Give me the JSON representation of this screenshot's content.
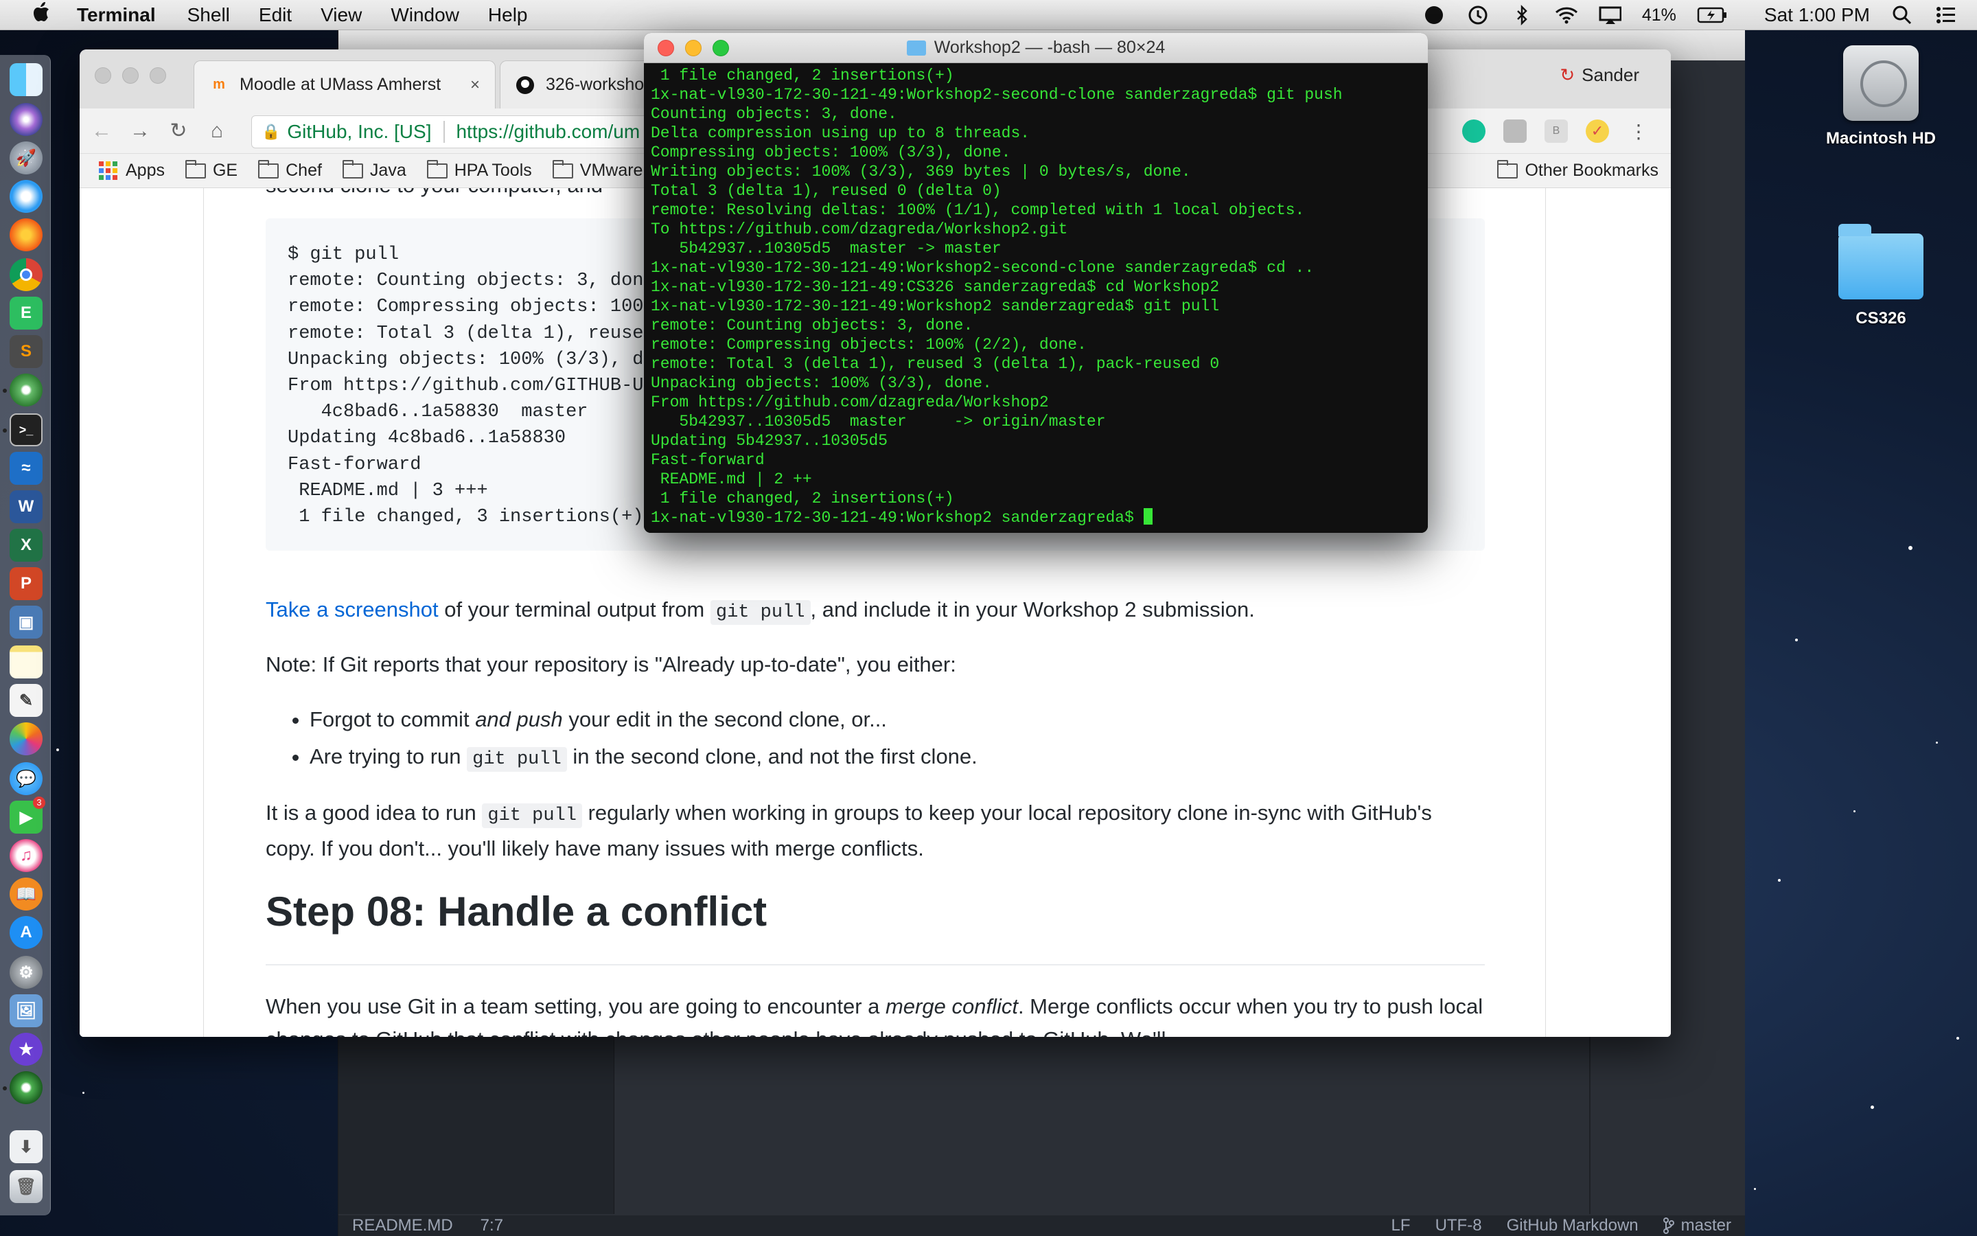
{
  "menubar": {
    "app_name": "Terminal",
    "menus": [
      "Shell",
      "Edit",
      "View",
      "Window",
      "Help"
    ],
    "battery": "41%",
    "clock": "Sat 1:00 PM"
  },
  "desktop": {
    "icons": [
      {
        "label": "Macintosh HD",
        "icon": "hard-drive-icon"
      },
      {
        "label": "CS326",
        "icon": "folder-icon"
      }
    ]
  },
  "dock": {
    "apps": [
      "finder",
      "siri",
      "launchpad",
      "safari",
      "firefox",
      "chrome",
      "evernote",
      "sublime-text",
      "atom",
      "terminal",
      "openoffice",
      "word",
      "excel",
      "powerpoint",
      "virtualbox",
      "notes",
      "textedit",
      "photos",
      "messages",
      "facetime",
      "itunes",
      "ibooks",
      "app-store",
      "system-preferences",
      "preview",
      "imovie",
      "atom-beta",
      "downloads",
      "trash"
    ],
    "facetime_badge": "3"
  },
  "browser": {
    "tabs": [
      {
        "title": "Moodle at UMass Amherst",
        "close": "×"
      },
      {
        "title": "326-worksho"
      }
    ],
    "profile": "Sander",
    "secure_label": "GitHub, Inc. [US]",
    "url": "https://github.com/um",
    "bookmarks": [
      "Apps",
      "GE",
      "Chef",
      "Java",
      "HPA Tools",
      "VMware"
    ],
    "other_bookmarks": "Other Bookmarks"
  },
  "page": {
    "top_cut_text": "second clone to your computer, and",
    "code_lines": [
      "$ git pull",
      "remote: Counting objects: 3, don",
      "remote: Compressing objects: 100",
      "remote: Total 3 (delta 1), reuse",
      "Unpacking objects: 100% (3/3), d",
      "From https://github.com/GITHUB-U",
      "   4c8bad6..1a58830  master",
      "Updating 4c8bad6..1a58830",
      "Fast-forward",
      " README.md | 3 +++",
      " 1 file changed, 3 insertions(+)"
    ],
    "screenshot_link": "Take a screenshot",
    "screenshot_pre": " of your terminal output from ",
    "screenshot_code": "git pull",
    "screenshot_post": ", and include it in your Workshop 2 submission.",
    "note": "Note: If Git reports that your repository is \"Already up-to-date\", you either:",
    "bullet1_pre": "Forgot to commit ",
    "bullet1_em": "and push",
    "bullet1_post": " your edit in the second clone, or...",
    "bullet2_pre": "Are trying to run ",
    "bullet2_code": "git pull",
    "bullet2_post": " in the second clone, and not the first clone.",
    "tip_pre": "It is a good idea to run ",
    "tip_code": "git pull",
    "tip_post": " regularly when working in groups to keep your local repository clone in-sync with GitHub's copy. If you don't... you'll likely have many issues with merge conflicts.",
    "heading": "Step 08: Handle a conflict",
    "merge_pre": "When you use Git in a team setting, you are going to encounter a ",
    "merge_em": "merge conflict",
    "merge_post": ". Merge conflicts occur when you try to push local changes to GitHub that conflict with changes other people have already pushed to GitHub. We'll"
  },
  "terminal": {
    "title": "Workshop2 — -bash — 80×24",
    "lines": [
      " 1 file changed, 2 insertions(+)",
      "1x-nat-vl930-172-30-121-49:Workshop2-second-clone sanderzagreda$ git push",
      "Counting objects: 3, done.",
      "Delta compression using up to 8 threads.",
      "Compressing objects: 100% (3/3), done.",
      "Writing objects: 100% (3/3), 369 bytes | 0 bytes/s, done.",
      "Total 3 (delta 1), reused 0 (delta 0)",
      "remote: Resolving deltas: 100% (1/1), completed with 1 local objects.",
      "To https://github.com/dzagreda/Workshop2.git",
      "   5b42937..10305d5  master -> master",
      "1x-nat-vl930-172-30-121-49:Workshop2-second-clone sanderzagreda$ cd ..",
      "1x-nat-vl930-172-30-121-49:CS326 sanderzagreda$ cd Workshop2",
      "1x-nat-vl930-172-30-121-49:Workshop2 sanderzagreda$ git pull",
      "remote: Counting objects: 3, done.",
      "remote: Compressing objects: 100% (2/2), done.",
      "remote: Total 3 (delta 1), reused 3 (delta 1), pack-reused 0",
      "Unpacking objects: 100% (3/3), done.",
      "From https://github.com/dzagreda/Workshop2",
      "   5b42937..10305d5  master     -> origin/master",
      "Updating 5b42937..10305d5",
      "Fast-forward",
      " README.md | 2 ++",
      " 1 file changed, 2 insertions(+)"
    ],
    "prompt": "1x-nat-vl930-172-30-121-49:Workshop2 sanderzagreda$ "
  },
  "atom": {
    "file": "README.MD",
    "cursor": "7:7",
    "line_ending": "LF",
    "encoding": "UTF-8",
    "grammar": "GitHub Markdown",
    "branch": "master"
  }
}
